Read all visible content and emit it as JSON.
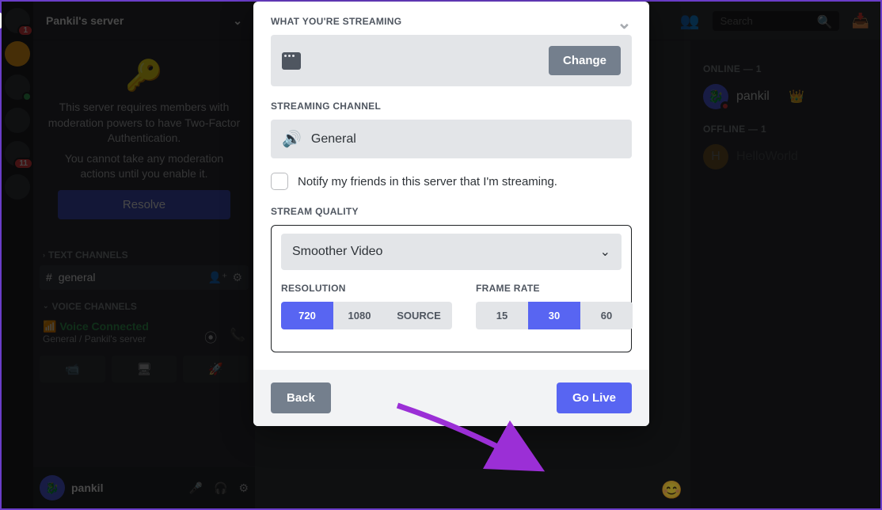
{
  "server": {
    "name": "Pankil's server"
  },
  "banner": {
    "line1": "This server requires members with moderation powers to have Two-Factor Authentication.",
    "line2": "You cannot take any moderation actions until you enable it.",
    "resolve": "Resolve"
  },
  "channels": {
    "text_header": "TEXT CHANNELS",
    "text_items": [
      "general"
    ],
    "voice_header": "VOICE CHANNELS"
  },
  "voice_panel": {
    "title": "Voice Connected",
    "sub": "General / Pankil's server"
  },
  "user_footer": {
    "name": "pankil"
  },
  "topbar": {
    "search_placeholder": "Search"
  },
  "members": {
    "online_header": "ONLINE — 1",
    "online_name": "pankil",
    "offline_header": "OFFLINE — 1",
    "offline_name": "HelloWorld"
  },
  "modal": {
    "what_header": "WHAT YOU'RE STREAMING",
    "change": "Change",
    "channel_header": "STREAMING CHANNEL",
    "channel_name": "General",
    "notify_label": "Notify my friends in this server that I'm streaming.",
    "quality_header": "STREAM QUALITY",
    "dropdown": "Smoother Video",
    "res_header": "RESOLUTION",
    "res_options": [
      "720",
      "1080",
      "SOURCE"
    ],
    "res_selected": "720",
    "fps_header": "FRAME RATE",
    "fps_options": [
      "15",
      "30",
      "60"
    ],
    "fps_selected": "30",
    "back": "Back",
    "golive": "Go Live"
  },
  "rail": {
    "unread1": "1",
    "unread2": "11"
  }
}
